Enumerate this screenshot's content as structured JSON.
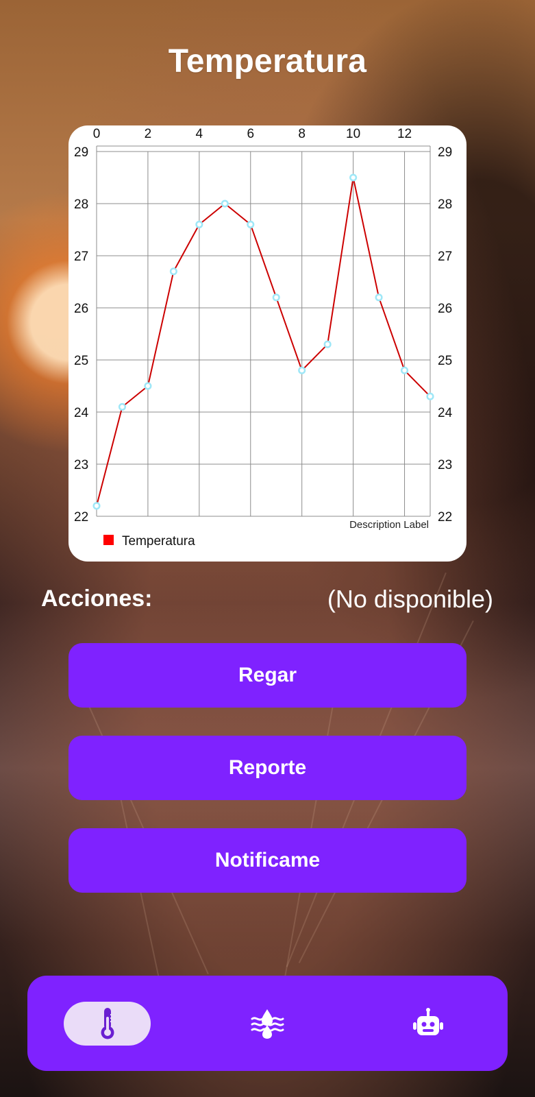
{
  "title": "Temperatura",
  "chart_data": {
    "type": "line",
    "x": [
      0,
      1,
      2,
      3,
      4,
      5,
      6,
      7,
      8,
      9,
      10,
      11,
      12,
      13
    ],
    "series": [
      {
        "name": "Temperatura",
        "values": [
          22.2,
          24.1,
          24.5,
          26.7,
          27.6,
          28.0,
          27.6,
          26.2,
          24.8,
          25.3,
          28.5,
          26.2,
          24.8,
          24.3
        ]
      }
    ],
    "x_ticks": [
      0,
      2,
      4,
      6,
      8,
      10,
      12
    ],
    "y_ticks": [
      22,
      23,
      24,
      25,
      26,
      27,
      28,
      29
    ],
    "xlim": [
      0,
      13
    ],
    "ylim": [
      22,
      29
    ],
    "grid": true,
    "legend_position": "bottom-left",
    "description_label": "Description Label",
    "series_color": "#cc0000",
    "marker_color": "#9ee7f7",
    "legend_color": "#ff0000"
  },
  "actions": {
    "label": "Acciones:",
    "status": "(No disponible)"
  },
  "buttons": {
    "regar": "Regar",
    "reporte": "Reporte",
    "notificame": "Notificame"
  },
  "nav": {
    "items": [
      {
        "icon": "thermometer-icon",
        "selected": true
      },
      {
        "icon": "water-drops-icon",
        "selected": false
      },
      {
        "icon": "robot-icon",
        "selected": false
      }
    ]
  },
  "colors": {
    "accent": "#7f22ff",
    "selected_nav_background": "#eadcf8"
  }
}
